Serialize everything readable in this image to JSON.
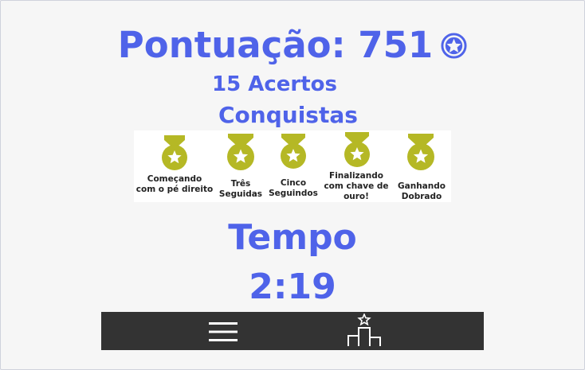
{
  "score": {
    "label": "Pontuação: 751"
  },
  "hits": "15 Acertos",
  "achievements": {
    "title": "Conquistas",
    "items": [
      {
        "label": "Começando\ncom o pé direito"
      },
      {
        "label": "Três\nSeguidas"
      },
      {
        "label": "Cinco\nSeguindos"
      },
      {
        "label": "Finalizando\ncom chave de\nouro!"
      },
      {
        "label": "Ganhando\nDobrado"
      }
    ]
  },
  "time": {
    "title": "Tempo",
    "value": "2:19"
  },
  "nav": {
    "menu_icon": "menu-icon",
    "ranking_icon": "podium-icon"
  },
  "colors": {
    "accent": "#4f63e9",
    "medal": "#b5b825",
    "bar": "#333333"
  }
}
